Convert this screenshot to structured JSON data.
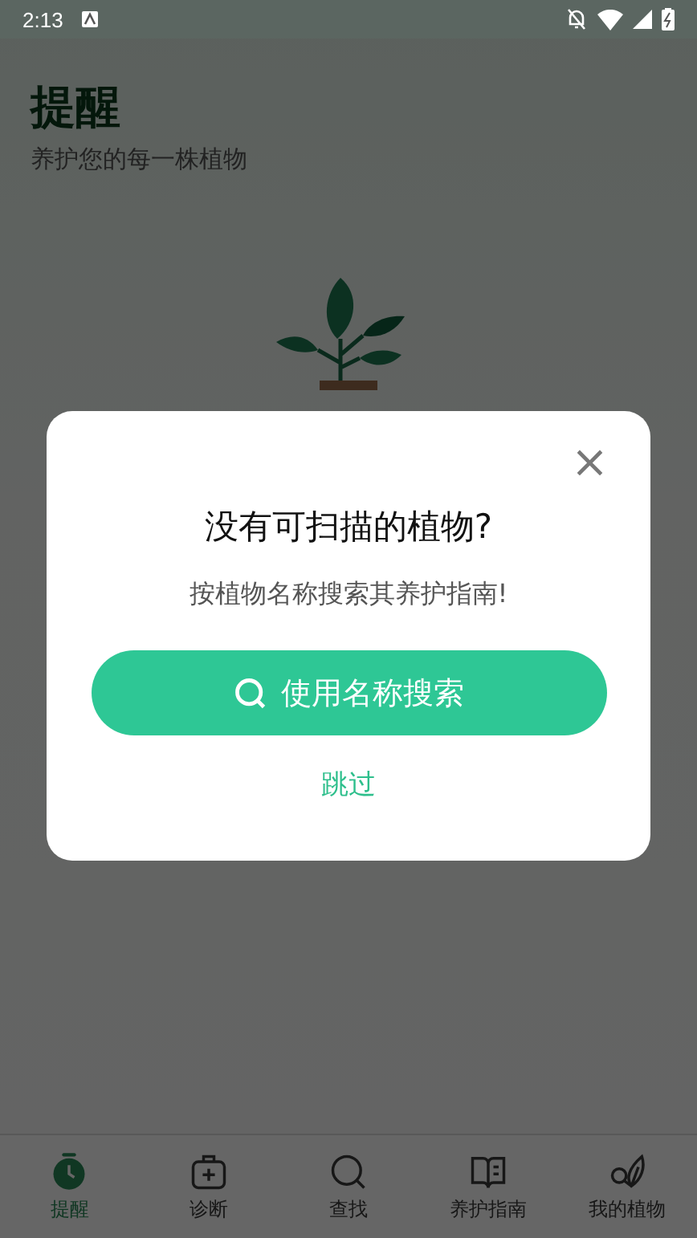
{
  "status_bar": {
    "time": "2:13"
  },
  "header": {
    "title": "提醒",
    "subtitle": "养护您的每一株植物"
  },
  "dialog": {
    "close": "×",
    "title": "没有可扫描的植物?",
    "message": "按植物名称搜索其养护指南!",
    "button": "使用名称搜索",
    "skip": "跳过"
  },
  "nav": [
    {
      "label": "提醒",
      "kind": "alarm",
      "selected": true
    },
    {
      "label": "诊断",
      "kind": "kit",
      "selected": false
    },
    {
      "label": "查找",
      "kind": "search",
      "selected": false
    },
    {
      "label": "养护指南",
      "kind": "book",
      "selected": false
    },
    {
      "label": "我的植物",
      "kind": "leaves",
      "selected": false
    }
  ]
}
